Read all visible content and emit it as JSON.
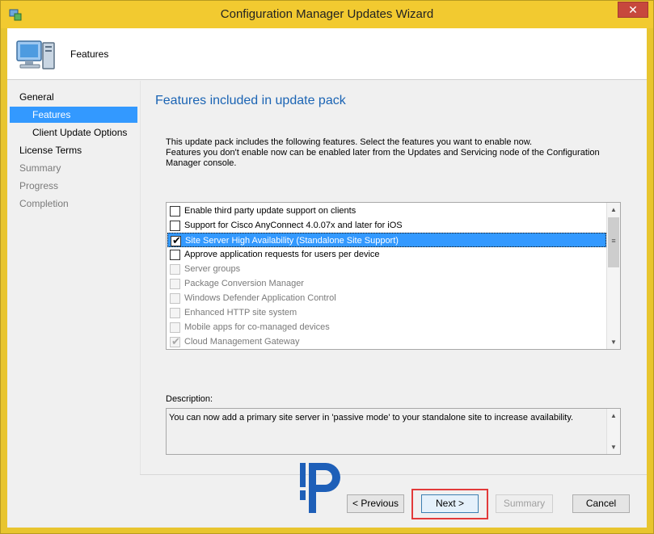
{
  "window": {
    "title": "Configuration Manager Updates Wizard",
    "close_glyph": "✕"
  },
  "header": {
    "title": "Features",
    "icon": "computer-icon"
  },
  "nav": {
    "items": [
      {
        "label": "General",
        "state": "normal",
        "indent": false
      },
      {
        "label": "Features",
        "state": "active",
        "indent": true
      },
      {
        "label": "Client Update Options",
        "state": "normal",
        "indent": true
      },
      {
        "label": "License Terms",
        "state": "normal",
        "indent": false
      },
      {
        "label": "Summary",
        "state": "disabled",
        "indent": false
      },
      {
        "label": "Progress",
        "state": "disabled",
        "indent": false
      },
      {
        "label": "Completion",
        "state": "disabled",
        "indent": false
      }
    ]
  },
  "main": {
    "heading": "Features included in update pack",
    "intro_line1": "This update pack includes the following features. Select the features you want to enable now.",
    "intro_line2": "Features you don't enable now can be enabled later from the Updates and Servicing node of the Configuration Manager console.",
    "features": [
      {
        "label": "Enable third party update support on clients",
        "checked": false,
        "enabled": true,
        "selected": false
      },
      {
        "label": "Support for Cisco AnyConnect 4.0.07x and later for iOS",
        "checked": false,
        "enabled": true,
        "selected": false
      },
      {
        "label": "Site Server High Availability (Standalone Site Support)",
        "checked": true,
        "enabled": true,
        "selected": true
      },
      {
        "label": "Approve application requests for users per device",
        "checked": false,
        "enabled": true,
        "selected": false
      },
      {
        "label": "Server groups",
        "checked": false,
        "enabled": false,
        "selected": false
      },
      {
        "label": "Package Conversion Manager",
        "checked": false,
        "enabled": false,
        "selected": false
      },
      {
        "label": "Windows Defender Application Control",
        "checked": false,
        "enabled": false,
        "selected": false
      },
      {
        "label": "Enhanced HTTP site system",
        "checked": false,
        "enabled": false,
        "selected": false
      },
      {
        "label": "Mobile apps for co-managed devices",
        "checked": false,
        "enabled": false,
        "selected": false
      },
      {
        "label": "Cloud Management Gateway",
        "checked": true,
        "enabled": false,
        "selected": false
      }
    ],
    "description_label": "Description:",
    "description_text": "You can now add a primary site server in 'passive mode' to your standalone site to increase availability."
  },
  "buttons": {
    "previous": "< Previous",
    "next": "Next >",
    "summary": "Summary",
    "cancel": "Cancel"
  },
  "colors": {
    "titlebar": "#f2ca30",
    "selection": "#3399ff",
    "heading": "#1b64b4",
    "highlight": "#e23a3a"
  }
}
